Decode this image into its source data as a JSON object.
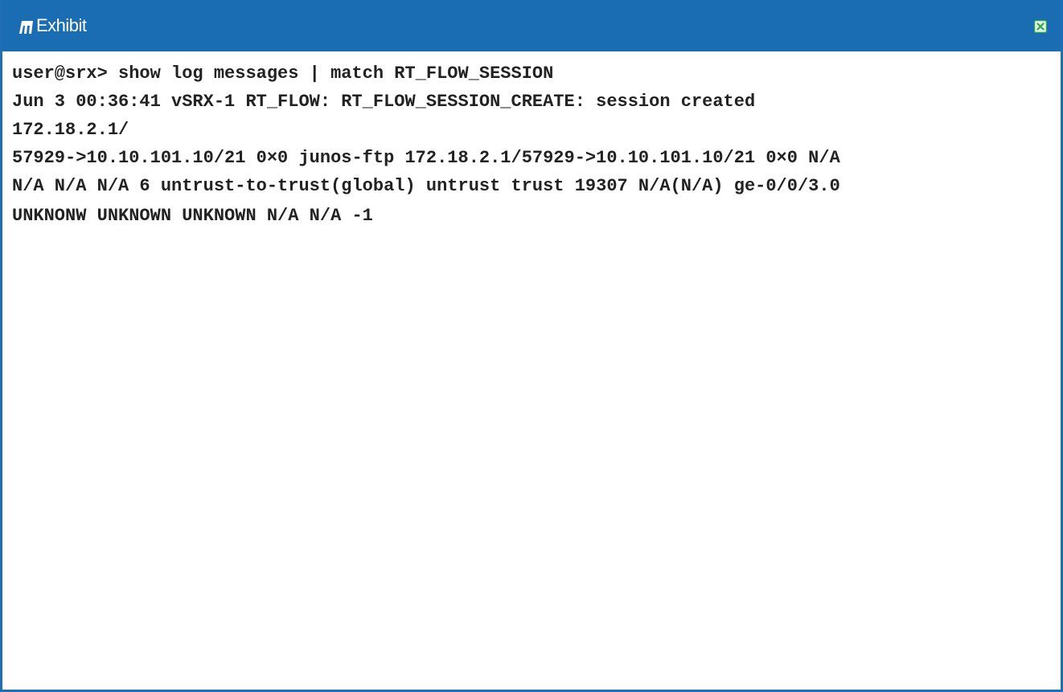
{
  "window": {
    "title": "Exhibit",
    "title_icon": "exhibit-icon",
    "close_icon": "close-icon",
    "colors": {
      "titlebar": "#1a6cb3",
      "text": "#222222",
      "close_icon": "#2fa84f"
    }
  },
  "terminal": {
    "lines": [
      "user@srx> show log messages | match RT_FLOW_SESSION",
      "Jun 3 00:36:41 vSRX-1 RT_FLOW: RT_FLOW_SESSION_CREATE: session created",
      "172.18.2.1/",
      "57929->10.10.101.10/21 0×0 junos-ftp 172.18.2.1/57929->10.10.101.10/21 0×0 N/A",
      "N/A N/A N/A 6 untrust-to-trust(global) untrust trust 19307 N/A(N/A) ge-0/0/3.0",
      "UNKNONW UNKNOWN UNKNOWN N/A N/A -1"
    ]
  }
}
